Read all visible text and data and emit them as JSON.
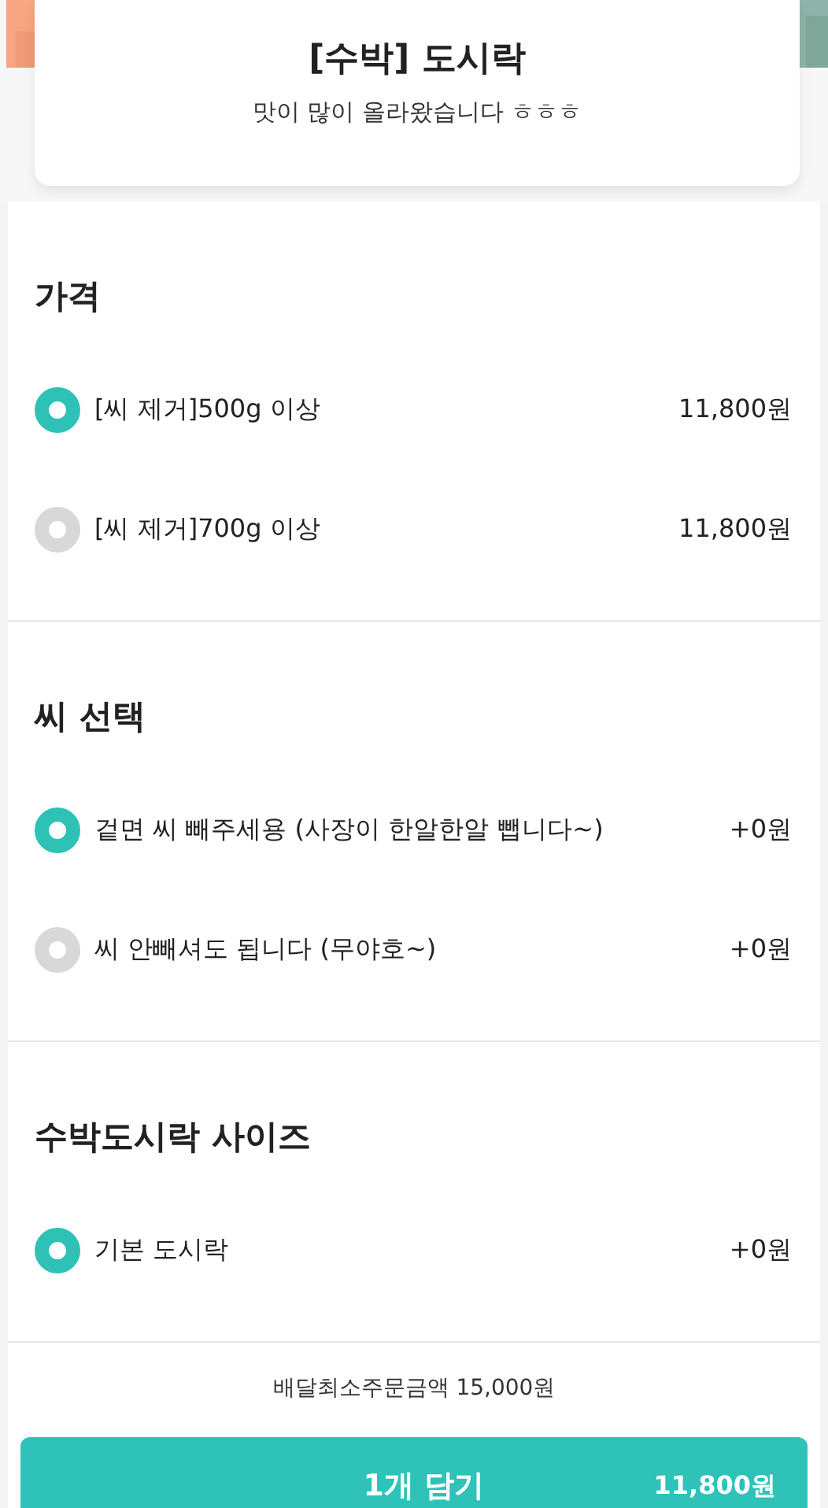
{
  "header": {
    "title": "[수박] 도시락",
    "subtitle": "맛이 많이 올라왔습니다 ㅎㅎㅎ"
  },
  "sections": [
    {
      "title": "가격",
      "options": [
        {
          "label": "[씨 제거]500g 이상",
          "price": "11,800원",
          "selected": true
        },
        {
          "label": "[씨 제거]700g 이상",
          "price": "11,800원",
          "selected": false
        }
      ]
    },
    {
      "title": "씨 선택",
      "options": [
        {
          "label": "겉면 씨 빼주세용 (사장이 한알한알 뺍니다~)",
          "price": "+0원",
          "selected": true
        },
        {
          "label": "씨 안빼셔도 됩니다 (무야호~)",
          "price": "+0원",
          "selected": false
        }
      ]
    },
    {
      "title": "수박도시락 사이즈",
      "options": [
        {
          "label": "기본 도시락",
          "price": "+0원",
          "selected": true
        }
      ]
    }
  ],
  "min_order": "배달최소주문금액 15,000원",
  "cart_button": {
    "label": "1개 담기",
    "price": "11,800원"
  }
}
